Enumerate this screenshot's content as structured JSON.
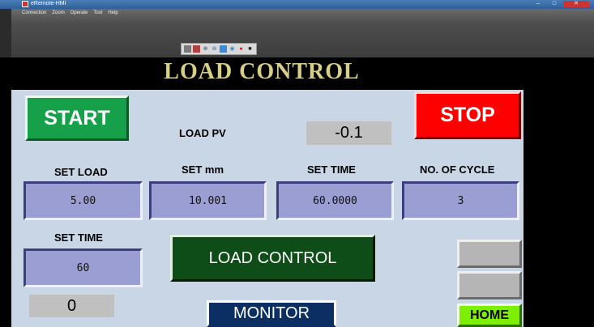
{
  "window": {
    "title": "eRemote-HMI",
    "controls": [
      "–",
      "□",
      "✕"
    ]
  },
  "menu": [
    "Connection",
    "Zoom",
    "Operate",
    "Tool",
    "Help"
  ],
  "toolbar": {
    "icons": [
      "table-icon",
      "table-icon",
      "zoom-in-icon",
      "zoom-out-icon",
      "image-icon",
      "info-icon",
      "record-icon",
      "stop-icon"
    ]
  },
  "header": {
    "title": "LOAD CONTROL"
  },
  "buttons": {
    "start": "START",
    "stop": "STOP",
    "load_control": "LOAD CONTROL",
    "monitor": "MONITOR",
    "home": "HOME"
  },
  "load_pv": {
    "label": "LOAD PV",
    "value": "-0.1"
  },
  "params": [
    {
      "label": "SET LOAD",
      "value": "5.00"
    },
    {
      "label": "SET mm",
      "value": "10.001"
    },
    {
      "label": "SET TIME",
      "value": "60.0000"
    },
    {
      "label": "NO. OF CYCLE",
      "value": "3"
    }
  ],
  "set_time_2": {
    "label": "SET TIME",
    "value": "60"
  },
  "counter": {
    "value": "0"
  },
  "colors": {
    "start": "#17a04a",
    "stop": "#ff0000",
    "load_control": "#0e4d17",
    "monitor": "#0b2f63",
    "home": "#7cf000",
    "field": "#9a9ed3",
    "panel": "#c9d6e6",
    "title": "#d8cf86"
  }
}
